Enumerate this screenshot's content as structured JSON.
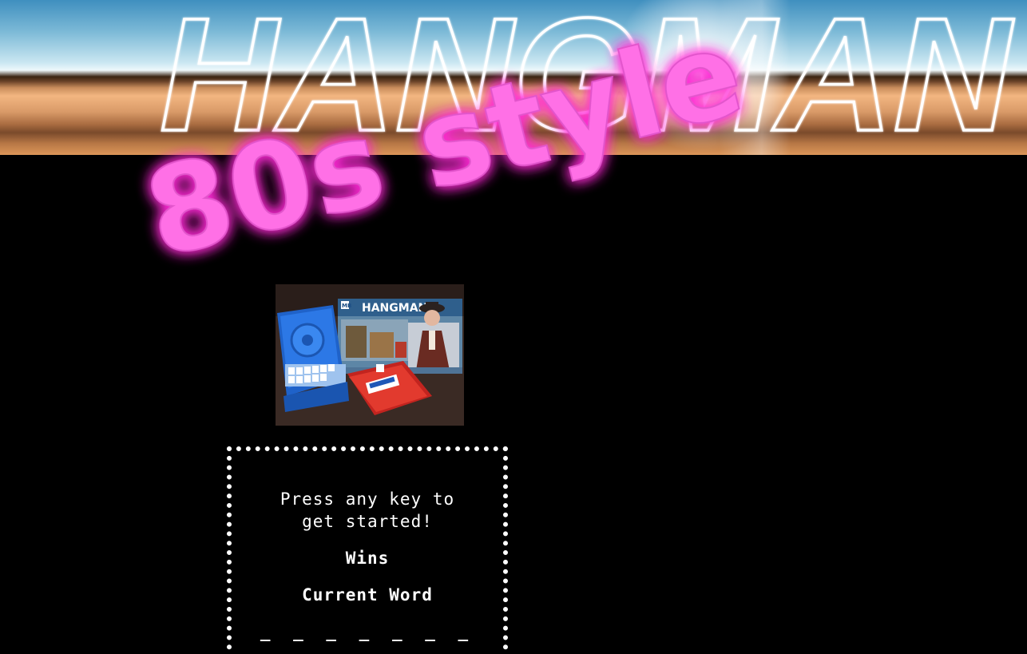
{
  "header": {
    "title": "HANGMAN",
    "subtitle": "80s style"
  },
  "game": {
    "prompt": "Press any key to get started!",
    "wins_label": "Wins",
    "current_word_label": "Current Word",
    "word_blanks": "_ _ _ _ _ _ _"
  },
  "image": {
    "box_title": "HANGMAN",
    "box_brand": "MB"
  },
  "colors": {
    "neon_pink": "#ff66e8",
    "neon_glow": "#ff2bd6",
    "background": "#000000",
    "text": "#ffffff"
  }
}
